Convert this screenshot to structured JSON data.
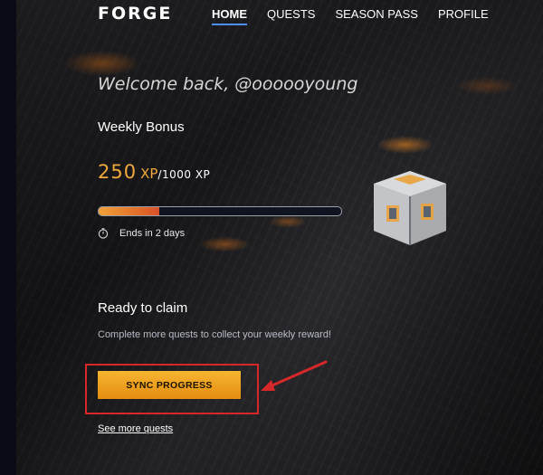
{
  "brand": {
    "logo_text": "FORGE"
  },
  "nav": {
    "items": [
      {
        "label": "HOME",
        "active": true
      },
      {
        "label": "QUESTS",
        "active": false
      },
      {
        "label": "SEASON PASS",
        "active": false
      },
      {
        "label": "PROFILE",
        "active": false
      }
    ]
  },
  "welcome": {
    "text": "Welcome back, @oooooyoung"
  },
  "weekly_bonus": {
    "title": "Weekly Bonus",
    "xp_current": "250",
    "xp_unit": "XP",
    "xp_total": "/1000 XP",
    "progress_fraction": 0.25,
    "ends_text": "Ends in 2 days"
  },
  "claim": {
    "title": "Ready to claim",
    "description": "Complete more quests to collect your weekly reward!",
    "button_label": "SYNC PROGRESS",
    "link_label": "See more quests"
  },
  "colors": {
    "accent": "#f0a83c",
    "button": "#f0a123",
    "highlight": "#d62828",
    "nav_underline": "#4c8ff0"
  },
  "icons": {
    "clock": "clock-icon",
    "reward": "loot-box-icon",
    "pointer": "arrow-icon"
  }
}
